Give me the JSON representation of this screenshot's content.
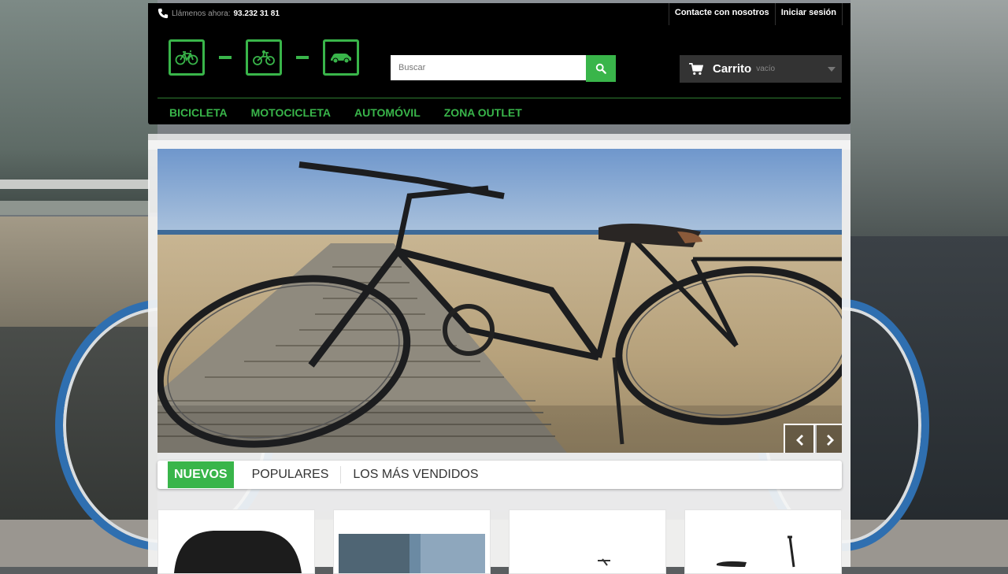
{
  "topbar": {
    "phone_label": "Llámenos ahora:",
    "phone_number": "93.232 31 81",
    "links": [
      "Contacte con nosotros",
      "Iniciar sesión"
    ]
  },
  "logo": {
    "icons": [
      "bicycle-icon",
      "motorcycle-icon",
      "car-icon"
    ],
    "separator": "-"
  },
  "search": {
    "placeholder": "Buscar",
    "icon": "search-icon"
  },
  "cart": {
    "label": "Carrito",
    "status": "vacío",
    "icon": "cart-icon"
  },
  "menu": {
    "items": [
      "BICICLETA",
      "MOTOCICLETA",
      "AUTOMÓVIL",
      "ZONA OUTLET"
    ]
  },
  "slider": {
    "prev_icon": "chevron-left-icon",
    "next_icon": "chevron-right-icon"
  },
  "tabs": {
    "items": [
      "NUEVOS",
      "POPULARES",
      "LOS MÁS VENDIDOS"
    ],
    "active": "NUEVOS"
  },
  "colors": {
    "accent": "#39b54a",
    "header_bg": "#000000",
    "cart_bg": "#333333"
  }
}
